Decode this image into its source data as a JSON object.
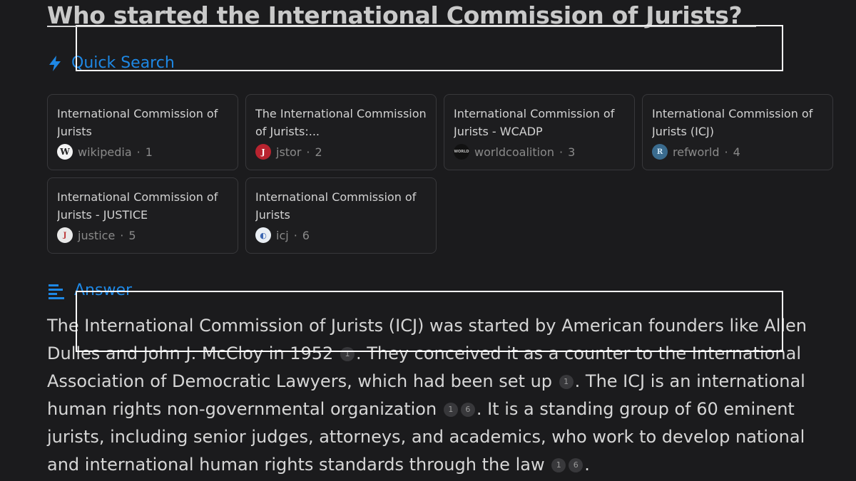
{
  "question": "Who started the International Commission of Jurists?",
  "quick_search": {
    "label": "Quick Search",
    "icon": "lightning-icon",
    "accent": "#1e88e5",
    "cards": [
      {
        "title": "International Commission of Jurists",
        "source": "wikipedia",
        "index": "1",
        "favicon": "W"
      },
      {
        "title": "The International Commission of Jurists:...",
        "source": "jstor",
        "index": "2",
        "favicon": "J"
      },
      {
        "title": "International Commission of Jurists - WCADP",
        "source": "worldcoalition",
        "index": "3",
        "favicon": "WORLD"
      },
      {
        "title": "International Commission of Jurists (ICJ)",
        "source": "refworld",
        "index": "4",
        "favicon": "R"
      },
      {
        "title": "International Commission of Jurists - JUSTICE",
        "source": "justice",
        "index": "5",
        "favicon": "J"
      },
      {
        "title": "International Commission of Jurists",
        "source": "icj",
        "index": "6",
        "favicon": "◐"
      }
    ]
  },
  "answer": {
    "label": "Answer",
    "icon": "text-lines-icon",
    "segments": [
      "The International Commission of Jurists (ICJ) was started by American founders like Allen Dulles and John J. McCloy in 1952",
      ". They conceived it as a counter to the International Association of Democratic Lawyers, which had been set up",
      ". The ICJ is an international human rights non-governmental organization",
      ". It is a standing group of 60 eminent jurists, including senior judges, attorneys, and academics, who work to develop national and international human rights standards through the law",
      "."
    ],
    "citations": [
      [
        "1"
      ],
      [
        "1"
      ],
      [
        "1",
        "6"
      ],
      [
        "1",
        "6"
      ]
    ]
  }
}
